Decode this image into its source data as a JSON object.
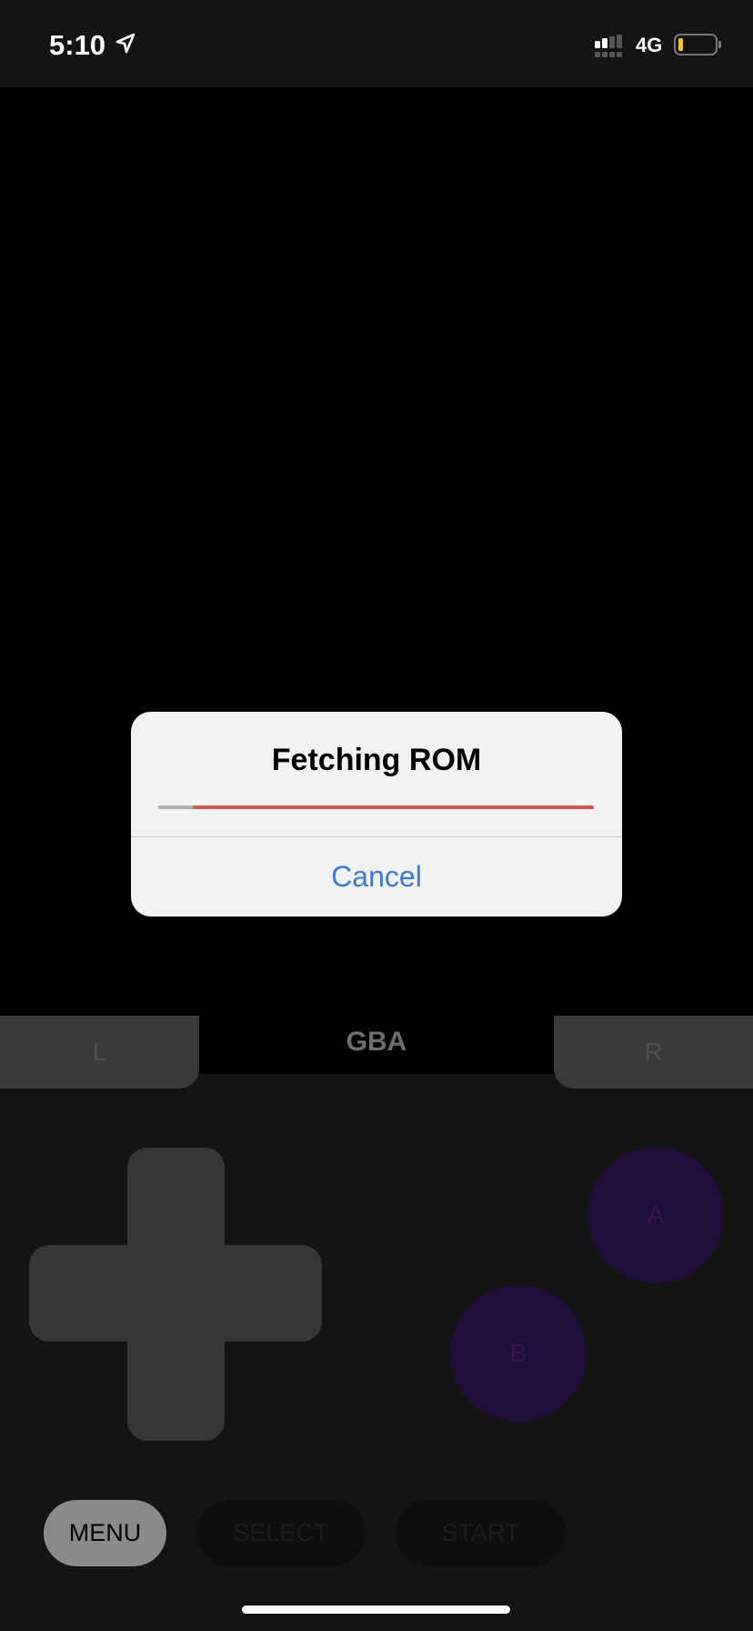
{
  "status_bar": {
    "time": "5:10",
    "network": "4G",
    "icons": [
      "location-arrow-icon",
      "signal-icon",
      "battery-icon"
    ],
    "battery_color": "#f5c542"
  },
  "dialog": {
    "title": "Fetching ROM",
    "progress_percent": 8,
    "progress_color": "#cc5a50",
    "cancel_label": "Cancel",
    "cancel_color": "#3a7bd5"
  },
  "controller": {
    "system_label": "GBA",
    "l_label": "L",
    "r_label": "R",
    "a_label": "A",
    "b_label": "B",
    "menu_label": "MENU",
    "select_label": "SELECT",
    "start_label": "START"
  }
}
